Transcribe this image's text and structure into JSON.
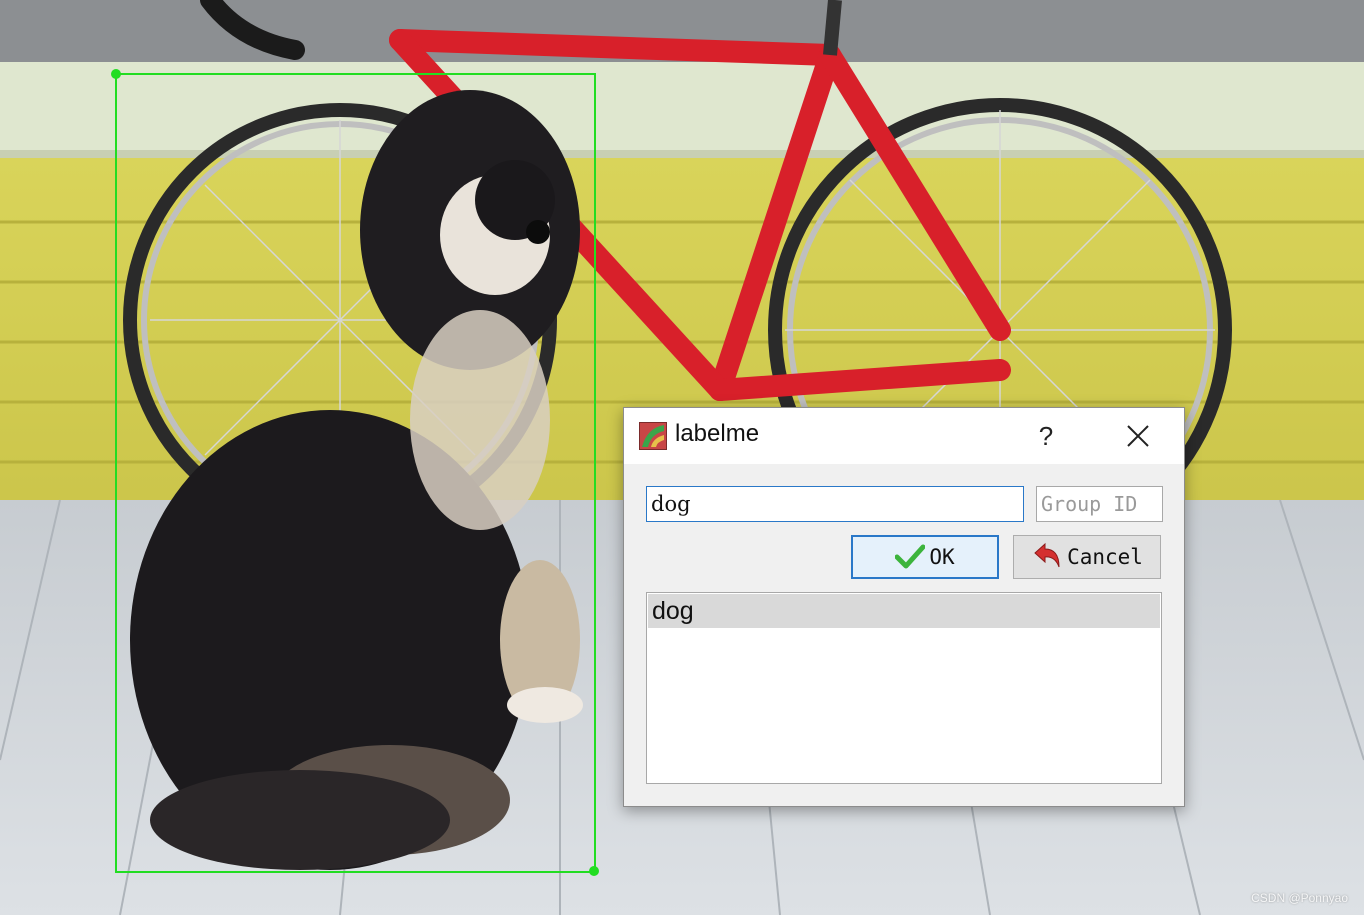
{
  "dialog": {
    "title": "labelme",
    "help_label": "?",
    "label_input_value": "dog",
    "group_id_placeholder": "Group ID",
    "ok_label": "OK",
    "cancel_label": "Cancel",
    "label_list": [
      {
        "label": "dog",
        "selected": true
      }
    ],
    "icons": {
      "app": "labelme-app-icon",
      "help": "help-icon",
      "close": "close-icon",
      "ok": "check-icon",
      "cancel": "undo-arrow-icon"
    },
    "colors": {
      "focus_border": "#2a78c8",
      "selected_row": "#d9d9d9",
      "ok_check": "#3cb43c",
      "cancel_arrow": "#d43030"
    }
  },
  "annotation": {
    "shape": "rectangle",
    "color": "#22dd22"
  },
  "image": {
    "subject_icon": "photo-dog-and-bicycle"
  },
  "watermark": "CSDN @Ponnyao"
}
